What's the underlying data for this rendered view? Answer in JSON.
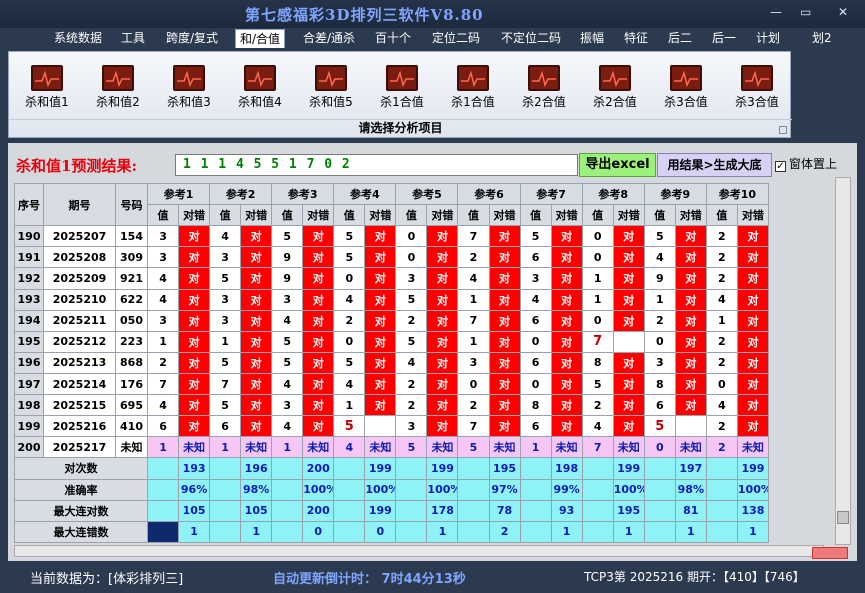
{
  "window": {
    "title": "第七感福彩3D排列三软件V8.80",
    "minimize": "—",
    "restore": "▭",
    "close": "✕"
  },
  "menu": [
    "系统数据",
    "工具",
    "跨度/复式",
    "和/合值",
    "合差/通杀",
    "百十个",
    "定位二码",
    "不定位二码",
    "振幅",
    "特征",
    "后二",
    "后一",
    "计划",
    "划2"
  ],
  "ribbon": {
    "buttons": [
      "杀和值1",
      "杀和值2",
      "杀和值3",
      "杀和值4",
      "杀和值5",
      "杀1合值",
      "杀1合值",
      "杀2合值",
      "杀2合值",
      "杀3合值",
      "杀3合值"
    ],
    "caption": "请选择分析项目"
  },
  "result": {
    "label": "杀和值1预测结果:",
    "value": "1 1 1 4 5 5 1 7 0 2",
    "export_label": "导出excel",
    "generate_label": "用结果>生成大底",
    "on_top_label": "窗体置上",
    "on_top_checked": true
  },
  "table": {
    "col_seq": "序号",
    "col_period": "期号",
    "col_code": "号码",
    "ref_headers": [
      "参考1",
      "参考2",
      "参考3",
      "参考4",
      "参考5",
      "参考6",
      "参考7",
      "参考8",
      "参考9",
      "参考10"
    ],
    "sub_value": "值",
    "sub_result": "对错",
    "rows": [
      {
        "seq": "190",
        "period": "2025207",
        "code": "154",
        "refs": [
          [
            "3",
            "对"
          ],
          [
            "4",
            "对"
          ],
          [
            "5",
            "对"
          ],
          [
            "5",
            "对"
          ],
          [
            "0",
            "对"
          ],
          [
            "7",
            "对"
          ],
          [
            "5",
            "对"
          ],
          [
            "0",
            "对"
          ],
          [
            "5",
            "对"
          ],
          [
            "2",
            "对"
          ]
        ]
      },
      {
        "seq": "191",
        "period": "2025208",
        "code": "309",
        "refs": [
          [
            "3",
            "对"
          ],
          [
            "3",
            "对"
          ],
          [
            "9",
            "对"
          ],
          [
            "5",
            "对"
          ],
          [
            "0",
            "对"
          ],
          [
            "2",
            "对"
          ],
          [
            "6",
            "对"
          ],
          [
            "0",
            "对"
          ],
          [
            "4",
            "对"
          ],
          [
            "2",
            "对"
          ]
        ]
      },
      {
        "seq": "192",
        "period": "2025209",
        "code": "921",
        "refs": [
          [
            "4",
            "对"
          ],
          [
            "5",
            "对"
          ],
          [
            "9",
            "对"
          ],
          [
            "0",
            "对"
          ],
          [
            "3",
            "对"
          ],
          [
            "4",
            "对"
          ],
          [
            "3",
            "对"
          ],
          [
            "1",
            "对"
          ],
          [
            "9",
            "对"
          ],
          [
            "2",
            "对"
          ]
        ]
      },
      {
        "seq": "193",
        "period": "2025210",
        "code": "622",
        "refs": [
          [
            "4",
            "对"
          ],
          [
            "3",
            "对"
          ],
          [
            "3",
            "对"
          ],
          [
            "4",
            "对"
          ],
          [
            "5",
            "对"
          ],
          [
            "1",
            "对"
          ],
          [
            "4",
            "对"
          ],
          [
            "1",
            "对"
          ],
          [
            "1",
            "对"
          ],
          [
            "4",
            "对"
          ]
        ]
      },
      {
        "seq": "194",
        "period": "2025211",
        "code": "050",
        "refs": [
          [
            "3",
            "对"
          ],
          [
            "3",
            "对"
          ],
          [
            "4",
            "对"
          ],
          [
            "2",
            "对"
          ],
          [
            "2",
            "对"
          ],
          [
            "7",
            "对"
          ],
          [
            "6",
            "对"
          ],
          [
            "0",
            "对"
          ],
          [
            "2",
            "对"
          ],
          [
            "1",
            "对"
          ]
        ]
      },
      {
        "seq": "195",
        "period": "2025212",
        "code": "223",
        "refs": [
          [
            "1",
            "对"
          ],
          [
            "1",
            "对"
          ],
          [
            "5",
            "对"
          ],
          [
            "0",
            "对"
          ],
          [
            "5",
            "对"
          ],
          [
            "1",
            "对"
          ],
          [
            "0",
            "对"
          ],
          [
            "7",
            ""
          ],
          [
            "0",
            "对"
          ],
          [
            "2",
            "对"
          ]
        ]
      },
      {
        "seq": "196",
        "period": "2025213",
        "code": "868",
        "refs": [
          [
            "2",
            "对"
          ],
          [
            "5",
            "对"
          ],
          [
            "5",
            "对"
          ],
          [
            "5",
            "对"
          ],
          [
            "4",
            "对"
          ],
          [
            "3",
            "对"
          ],
          [
            "6",
            "对"
          ],
          [
            "8",
            "对"
          ],
          [
            "3",
            "对"
          ],
          [
            "2",
            "对"
          ]
        ]
      },
      {
        "seq": "197",
        "period": "2025214",
        "code": "176",
        "refs": [
          [
            "7",
            "对"
          ],
          [
            "7",
            "对"
          ],
          [
            "4",
            "对"
          ],
          [
            "4",
            "对"
          ],
          [
            "2",
            "对"
          ],
          [
            "0",
            "对"
          ],
          [
            "0",
            "对"
          ],
          [
            "5",
            "对"
          ],
          [
            "8",
            "对"
          ],
          [
            "0",
            "对"
          ]
        ]
      },
      {
        "seq": "198",
        "period": "2025215",
        "code": "695",
        "refs": [
          [
            "4",
            "对"
          ],
          [
            "5",
            "对"
          ],
          [
            "3",
            "对"
          ],
          [
            "1",
            "对"
          ],
          [
            "2",
            "对"
          ],
          [
            "2",
            "对"
          ],
          [
            "8",
            "对"
          ],
          [
            "2",
            "对"
          ],
          [
            "6",
            "对"
          ],
          [
            "4",
            "对"
          ]
        ]
      },
      {
        "seq": "199",
        "period": "2025216",
        "code": "410",
        "refs": [
          [
            "6",
            "对"
          ],
          [
            "6",
            "对"
          ],
          [
            "4",
            "对"
          ],
          [
            "5",
            ""
          ],
          [
            "3",
            "对"
          ],
          [
            "7",
            "对"
          ],
          [
            "6",
            "对"
          ],
          [
            "4",
            "对"
          ],
          [
            "5",
            ""
          ],
          [
            "2",
            "对"
          ]
        ]
      },
      {
        "seq": "200",
        "period": "2025217",
        "code": "未知",
        "refs": [
          [
            "1",
            "未知"
          ],
          [
            "1",
            "未知"
          ],
          [
            "1",
            "未知"
          ],
          [
            "4",
            "未知"
          ],
          [
            "5",
            "未知"
          ],
          [
            "5",
            "未知"
          ],
          [
            "1",
            "未知"
          ],
          [
            "7",
            "未知"
          ],
          [
            "0",
            "未知"
          ],
          [
            "2",
            "未知"
          ]
        ]
      }
    ],
    "stats": [
      {
        "label": "对次数",
        "values": [
          "193",
          "196",
          "200",
          "199",
          "199",
          "195",
          "198",
          "199",
          "197",
          "199"
        ]
      },
      {
        "label": "准确率",
        "values": [
          "96%",
          "98%",
          "100%",
          "100%",
          "100%",
          "97%",
          "99%",
          "100%",
          "98%",
          "100%"
        ]
      },
      {
        "label": "最大连对数",
        "values": [
          "105",
          "105",
          "200",
          "199",
          "178",
          "78",
          "93",
          "195",
          "81",
          "138"
        ]
      },
      {
        "label": "最大连错数",
        "values": [
          "1",
          "1",
          "0",
          "0",
          "1",
          "2",
          "1",
          "1",
          "1",
          "1"
        ]
      }
    ]
  },
  "status": {
    "current_data": "当前数据为：[体彩排列三]",
    "countdown": "自动更新倒计时： 7时44分13秒",
    "latest": "TCP3第 2025216 期开：【410】【746】"
  }
}
